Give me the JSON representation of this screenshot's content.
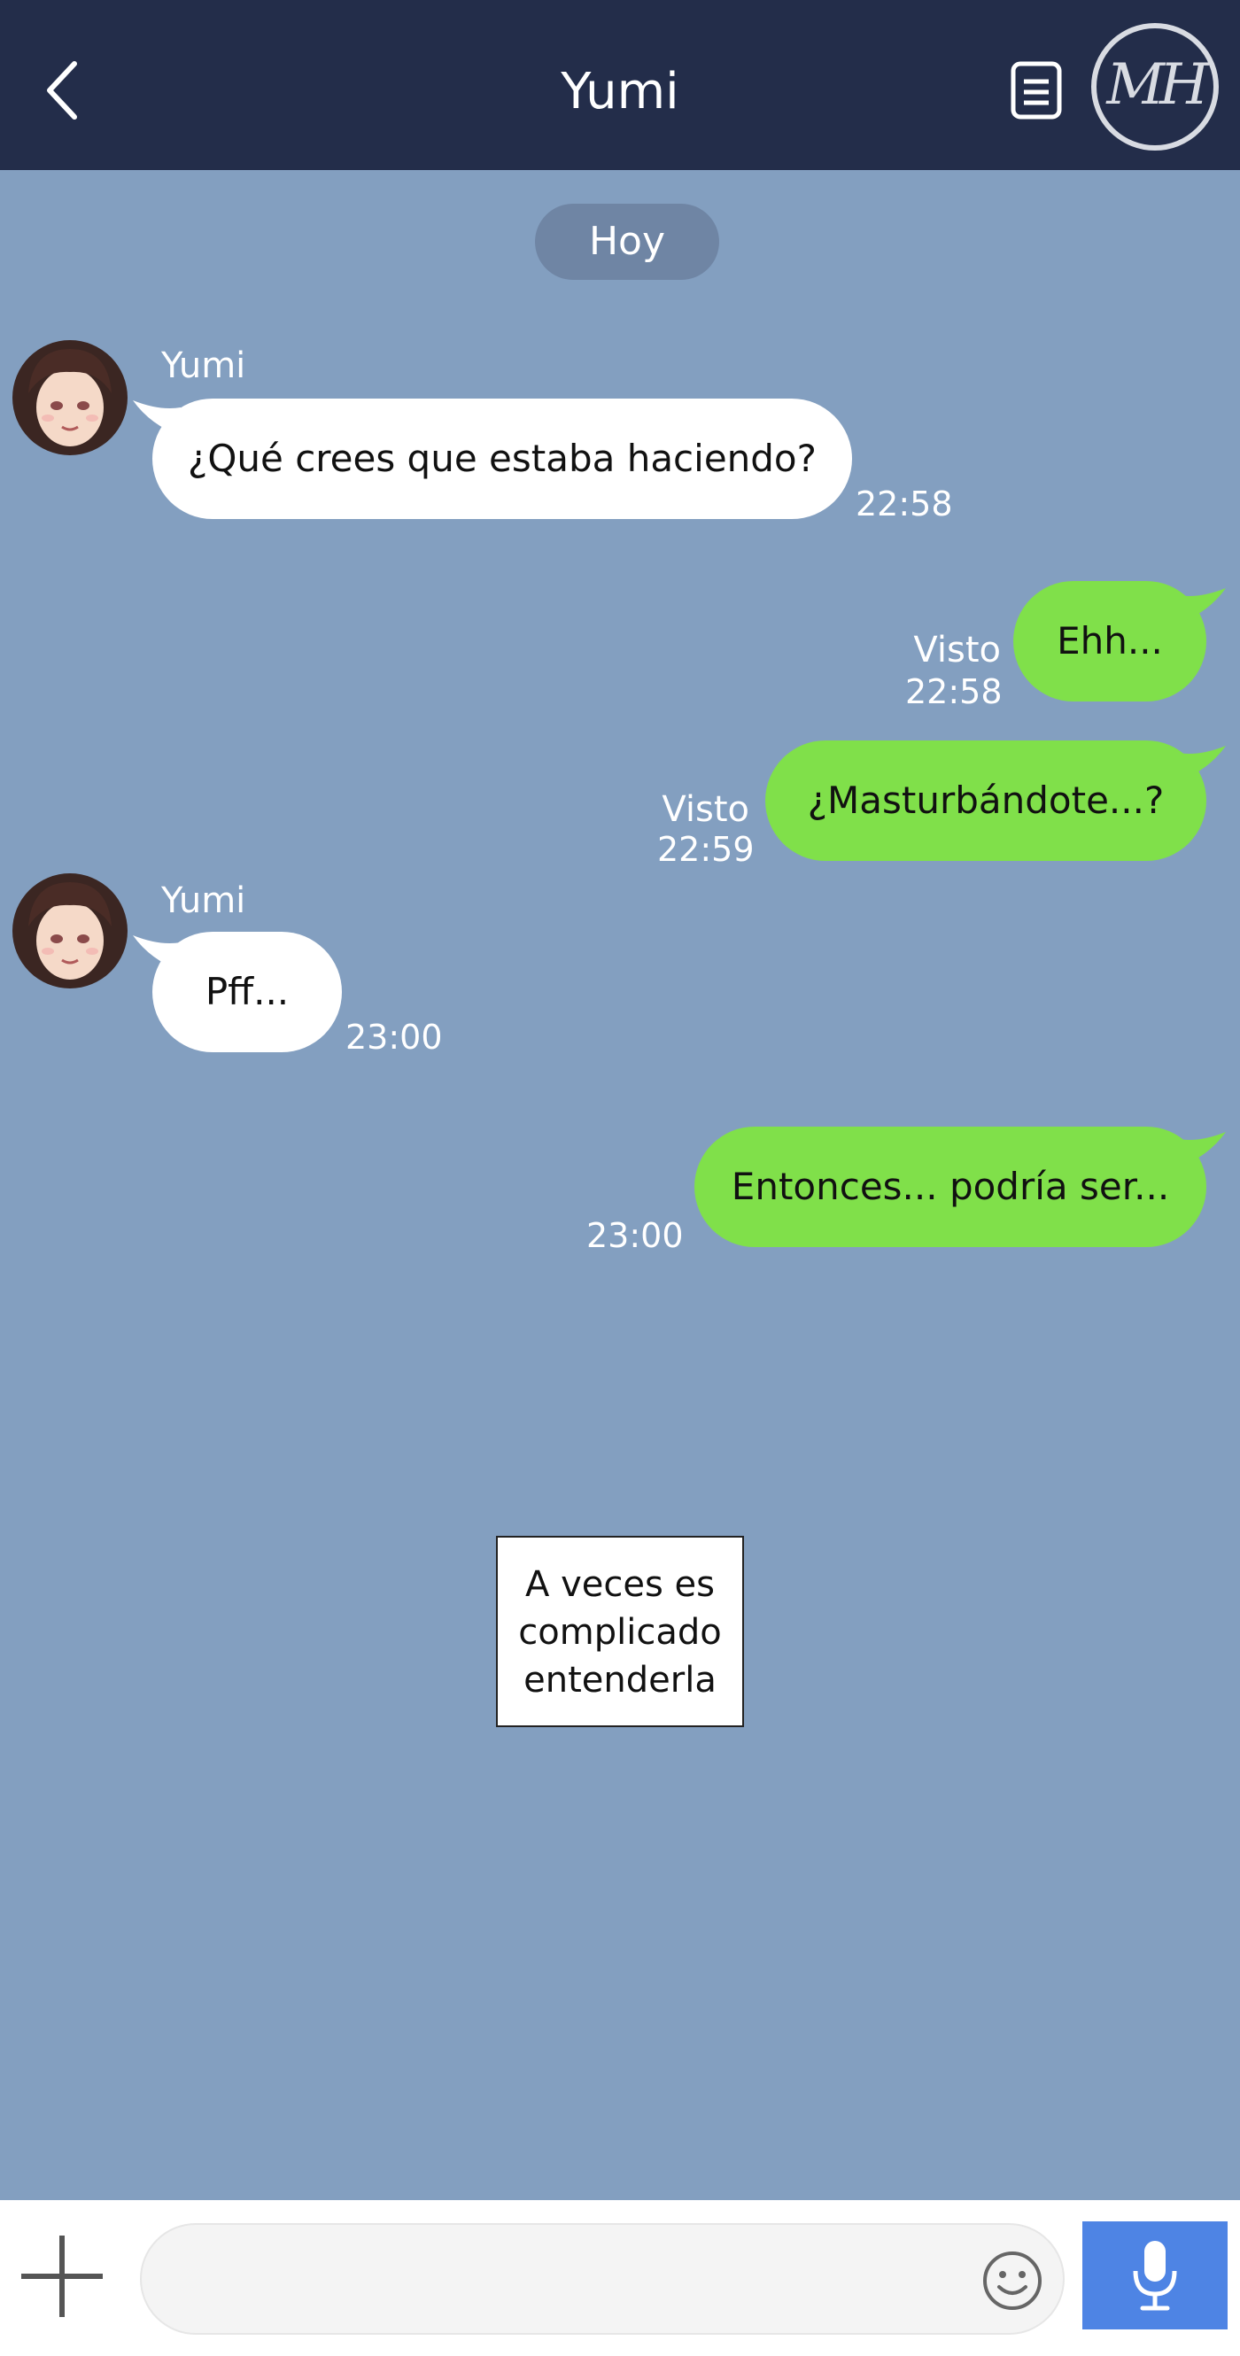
{
  "header": {
    "title": "Yumi",
    "back_icon": "chevron-left-icon",
    "menu_icon": "document-list-icon",
    "logo_text": "MH"
  },
  "date_divider": "Hoy",
  "messages": [
    {
      "side": "incoming",
      "sender": "Yumi",
      "text": "¿Qué crees que estaba haciendo?",
      "time": "22:58"
    },
    {
      "side": "outgoing",
      "text": "Ehh...",
      "status": "Visto",
      "time": "22:58"
    },
    {
      "side": "outgoing",
      "text": "¿Masturbándote...?",
      "status": "Visto",
      "time": "22:59"
    },
    {
      "side": "incoming",
      "sender": "Yumi",
      "text": "Pff...",
      "time": "23:00"
    },
    {
      "side": "outgoing",
      "text": "Entonces... podría ser...",
      "time": "23:00"
    }
  ],
  "narration": {
    "line1": "A veces es",
    "line2": "complicado",
    "line3": "entenderla"
  },
  "input_bar": {
    "placeholder": "",
    "add_icon": "plus-icon",
    "emoji_icon": "smiley-icon",
    "mic_icon": "microphone-icon"
  },
  "colors": {
    "header_bg": "#232d4a",
    "chat_bg": "#839fc0",
    "incoming_bubble": "#ffffff",
    "outgoing_bubble": "#80e04a",
    "mic_button": "#4e84e4"
  }
}
